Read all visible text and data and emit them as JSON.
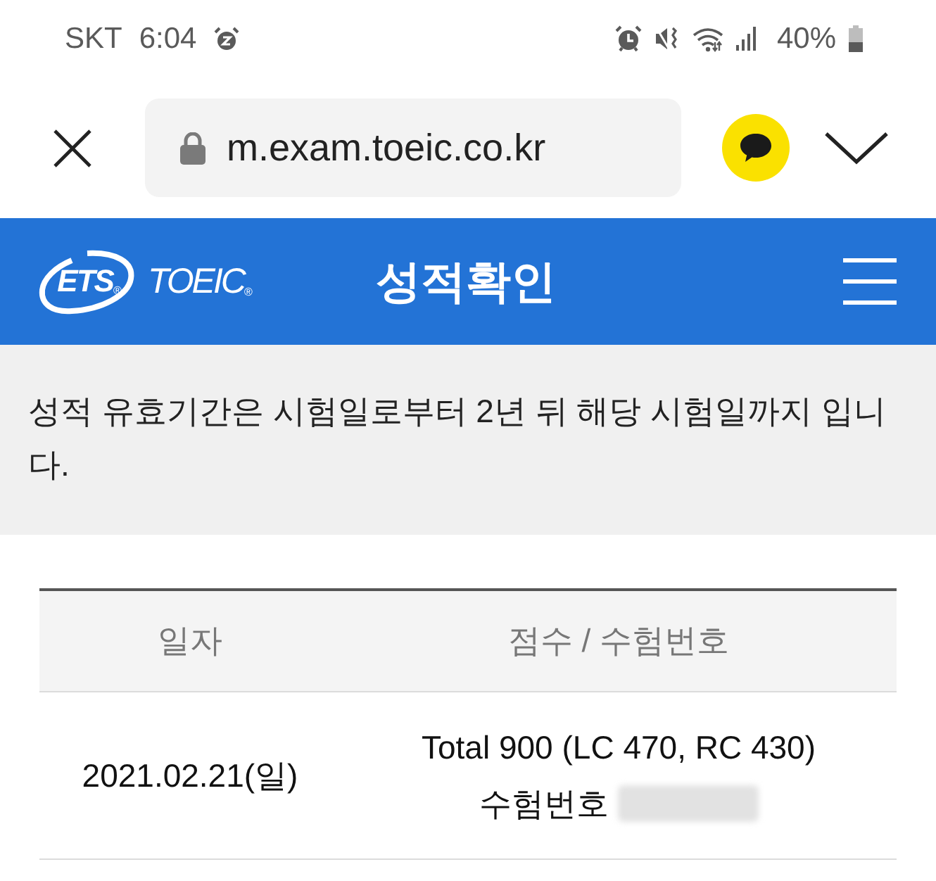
{
  "status_bar": {
    "carrier": "SKT",
    "time": "6:04",
    "battery": "40%"
  },
  "browser": {
    "url": "m.exam.toeic.co.kr"
  },
  "header": {
    "logo_ets": "ETS$_{®}$",
    "logo_toeic": "TOEIC$_{®}$",
    "title": "성적확인"
  },
  "notice": "성적 유효기간은 시험일로부터 2년 뒤 해당 시험일까지 입니다.",
  "table": {
    "columns": [
      "일자",
      "점수 / 수험번호"
    ],
    "rows": [
      {
        "date": "2021.02.21(일)",
        "score": "Total 900 (LC 470, RC 430)",
        "exam_number_label": "수험번호"
      }
    ]
  }
}
